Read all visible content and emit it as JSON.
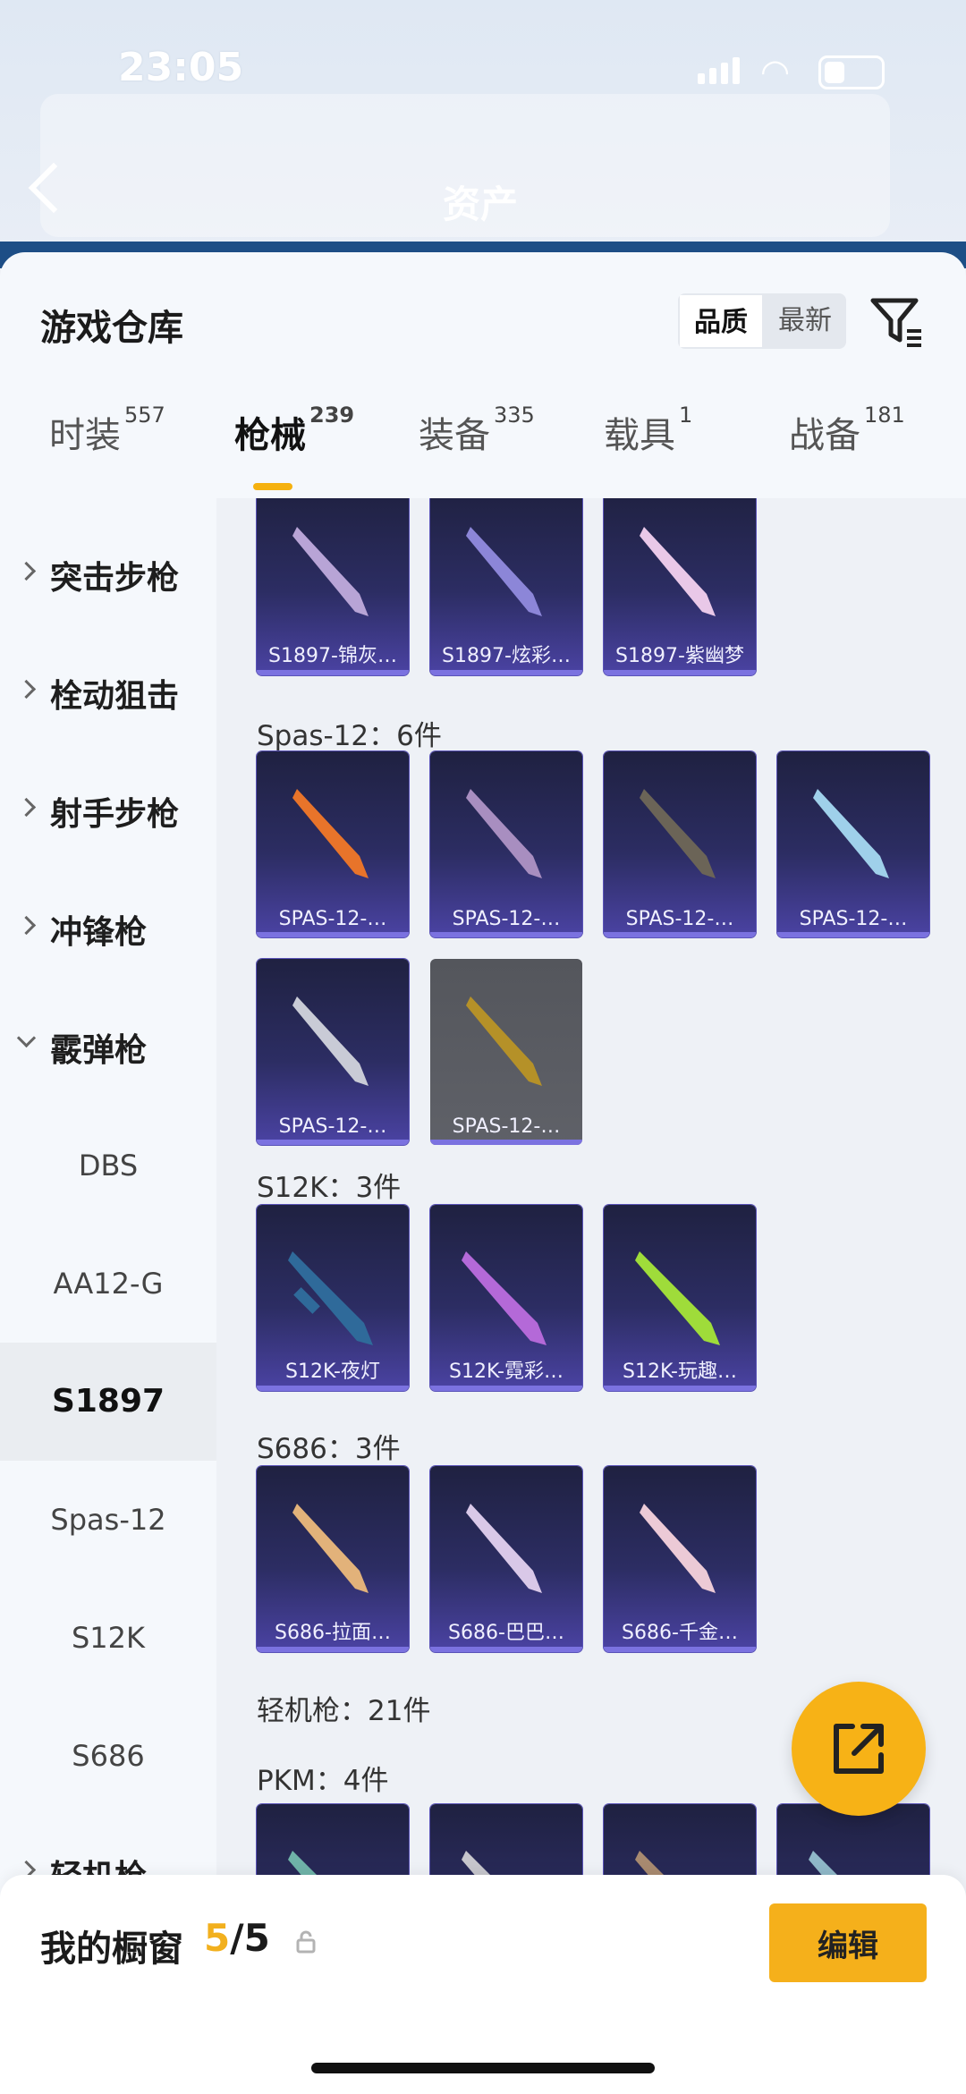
{
  "status": {
    "time": "23:05"
  },
  "background": {
    "title": "资产"
  },
  "sheet": {
    "title": "游戏仓库",
    "sort_quality": "品质",
    "sort_latest": "最新"
  },
  "tabs": [
    {
      "label": "时装",
      "count": "557"
    },
    {
      "label": "枪械",
      "count": "239"
    },
    {
      "label": "装备",
      "count": "335"
    },
    {
      "label": "载具",
      "count": "1"
    },
    {
      "label": "战备",
      "count": "181"
    }
  ],
  "nav": {
    "groups": [
      "突击步枪",
      "栓动狙击",
      "射手步枪",
      "冲锋枪",
      "霰弹枪",
      "轻机枪"
    ],
    "subs": [
      "DBS",
      "AA12-G",
      "S1897",
      "Spas-12",
      "S12K",
      "S686"
    ]
  },
  "content": {
    "row_s1897": [
      "S1897-锦灰…",
      "S1897-炫彩…",
      "S1897-紫幽梦"
    ],
    "spas_header": "Spas-12：6件",
    "spas_items": [
      "SPAS-12-…",
      "SPAS-12-…",
      "SPAS-12-…",
      "SPAS-12-…",
      "SPAS-12-…",
      "SPAS-12-…"
    ],
    "s12k_header": "S12K：3件",
    "s12k_items": [
      "S12K-夜灯",
      "S12K-霓彩…",
      "S12K-玩趣…"
    ],
    "s686_header": "S686：3件",
    "s686_items": [
      "S686-拉面…",
      "S686-巴巴…",
      "S686-千金…"
    ],
    "lmg_header": "轻机枪：21件",
    "pkm_header": "PKM：4件"
  },
  "bottom": {
    "showcase_label": "我的橱窗",
    "count_current": "5",
    "count_total": "/5",
    "edit_label": "编辑"
  },
  "colors": {
    "accent": "#f5b10f",
    "card_purple": "#4b43a4"
  }
}
